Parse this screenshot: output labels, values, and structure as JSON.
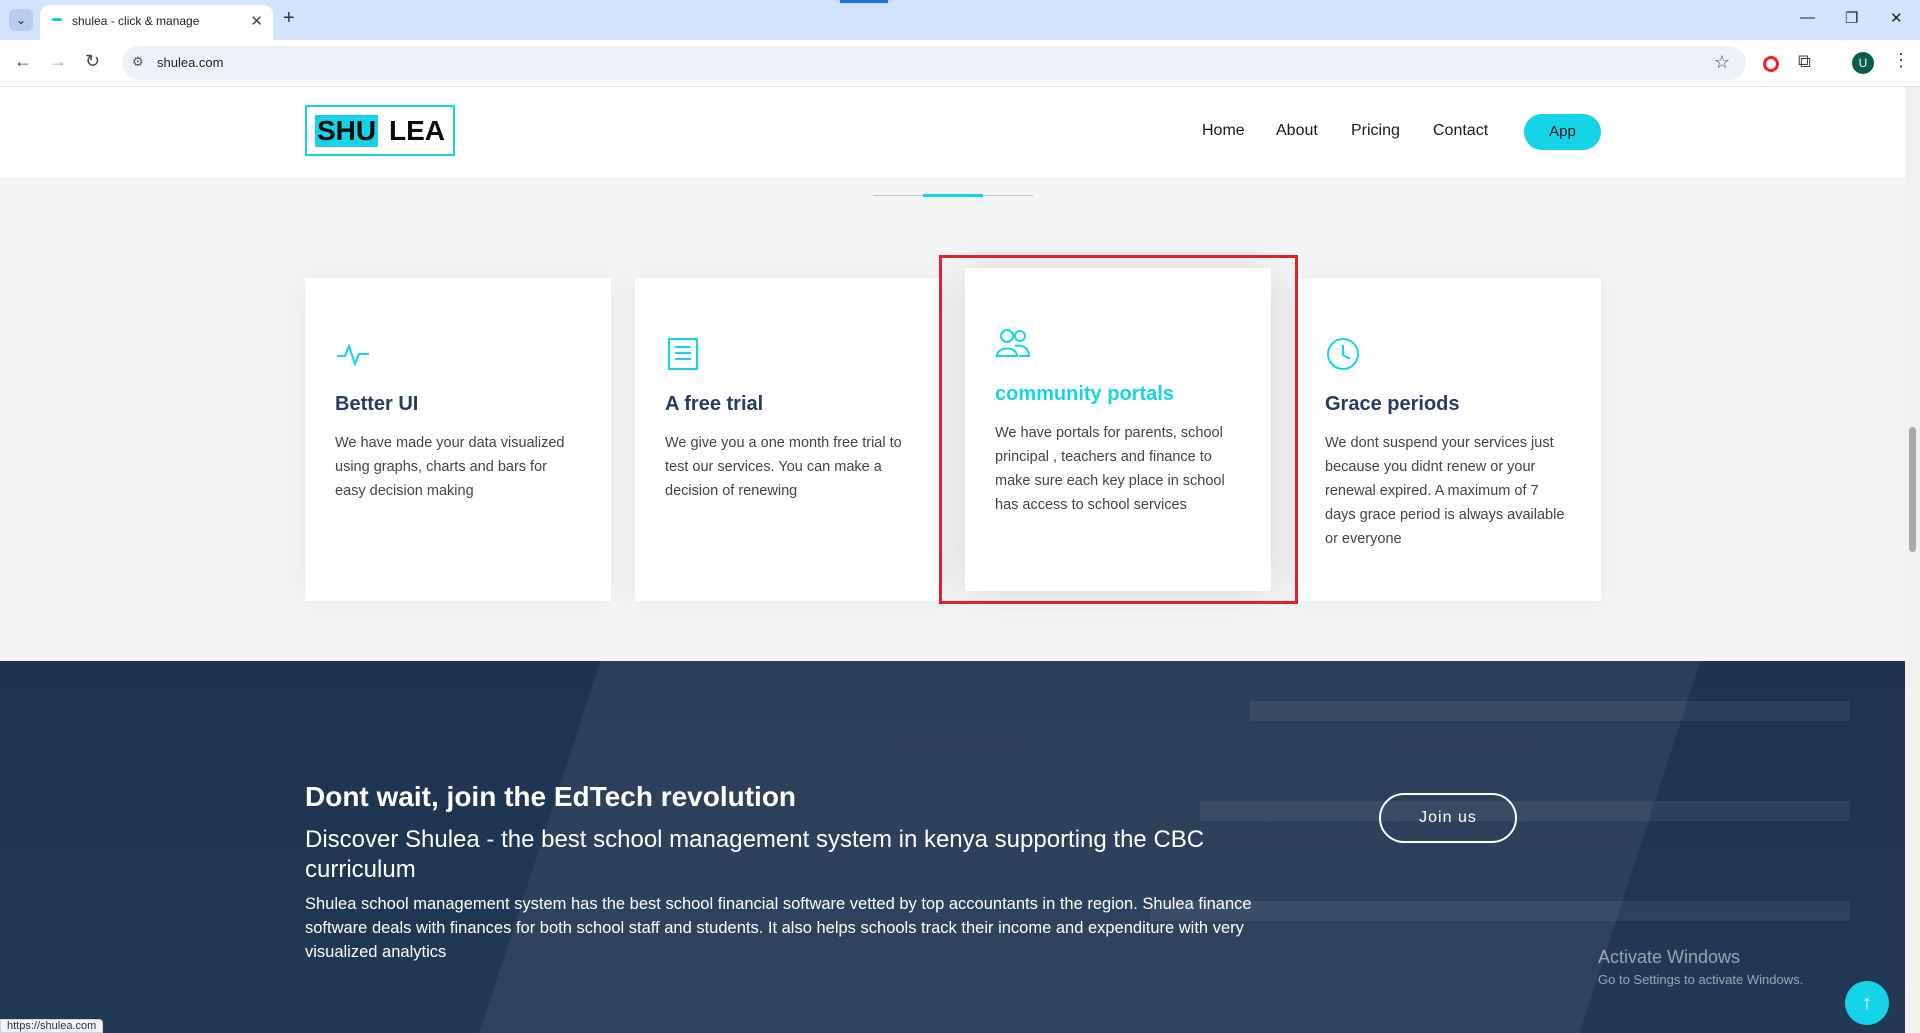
{
  "browser": {
    "tab_title": "shulea - click & manage",
    "tab_close": "✕",
    "new_tab": "+",
    "url": "shulea.com",
    "avatar_letter": "U",
    "status_url": "https://shulea.com"
  },
  "header": {
    "logo_left": "SHU",
    "logo_right": "LEA",
    "nav": [
      "Home",
      "About",
      "Pricing",
      "Contact"
    ],
    "app_button": "App"
  },
  "features": [
    {
      "icon": "activity-icon",
      "title": "Better UI",
      "text": "We have made your data visualized using graphs, charts and bars for easy decision making"
    },
    {
      "icon": "receipt-icon",
      "title": "A free trial",
      "text": "We give you a one month free trial to test our services. You can make a decision of renewing"
    },
    {
      "icon": "people-icon",
      "title": "community portals",
      "text": "We have portals for parents, school principal , teachers and finance to make sure each key place in school has access to school services"
    },
    {
      "icon": "clock-icon",
      "title": "Grace periods",
      "text": "We dont suspend your services just because you didnt renew or your renewal expired. A maximum of 7 days grace period is always available or everyone"
    }
  ],
  "cta": {
    "heading": "Dont wait, join the EdTech revolution",
    "subheading": "Discover Shulea - the best school management system in kenya supporting the CBC curriculum",
    "paragraph": "Shulea school management system has the best school financial software vetted by top accountants in the region. Shulea finance software deals with finances for both school staff and students. It also helps schools track their income and expenditure with very visualized analytics",
    "join_button": "Join us"
  },
  "watermark": {
    "title": "Activate Windows",
    "subtitle": "Go to Settings to activate Windows."
  },
  "colors": {
    "accent": "#16d4e8",
    "title_navy": "#2a3b63",
    "highlight_red": "#e0202c",
    "cta_bg": "#1f3350"
  }
}
